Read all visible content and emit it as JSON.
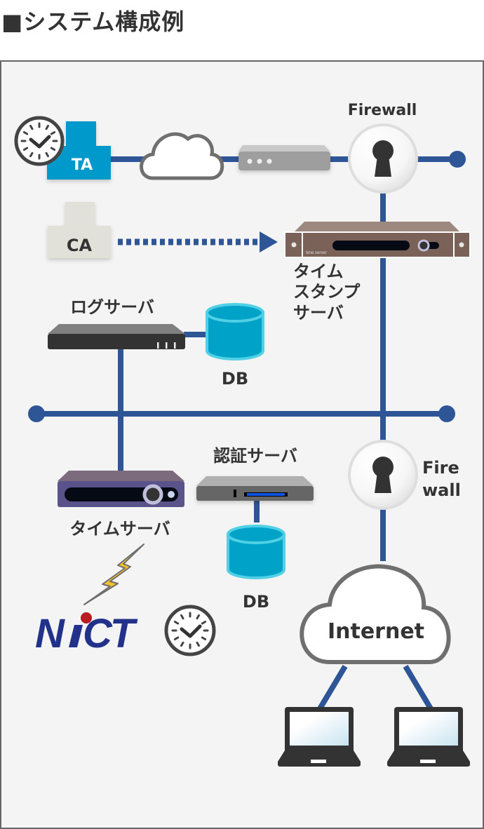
{
  "title": "■システム構成例",
  "colors": {
    "line": "#2e5596",
    "ta": "#0099cc",
    "ca": "#e1e1da",
    "db": "#00a2c8",
    "db_rim": "#4fd0e4",
    "text": "#333333",
    "frame_border": "#666666",
    "background": "#f4f4f4",
    "timestamp_server": "#7a6258",
    "time_server": "#5a528a",
    "nict_blue": "#22318a",
    "nict_red": "#b81c22",
    "bolt": "#f4c22a"
  },
  "nodes": {
    "ta": {
      "label": "TA",
      "icon": "clock-icon"
    },
    "cloud_top": {
      "icon": "cloud-icon"
    },
    "router": {
      "icon": "router-icon"
    },
    "firewall_top": {
      "label": "Firewall",
      "icon": "keyhole-icon"
    },
    "ca": {
      "label": "CA"
    },
    "timestamp_server": {
      "label_lines": [
        "タイム",
        "スタンプ",
        "サーバ"
      ],
      "device_text": "time server"
    },
    "log_server": {
      "label": "ログサーバ"
    },
    "log_db": {
      "label": "DB",
      "icon": "database-icon"
    },
    "auth_server": {
      "label": "認証サーバ"
    },
    "auth_db": {
      "label": "DB",
      "icon": "database-icon"
    },
    "time_server": {
      "label": "タイムサーバ"
    },
    "firewall_bottom": {
      "label_lines": [
        "Fire",
        "wall"
      ],
      "icon": "keyhole-icon"
    },
    "internet": {
      "label": "Internet",
      "icon": "cloud-icon"
    },
    "nict": {
      "label": "NICT",
      "icon": "clock-icon"
    },
    "clients": [
      {
        "icon": "laptop-icon"
      },
      {
        "icon": "laptop-icon"
      }
    ]
  }
}
